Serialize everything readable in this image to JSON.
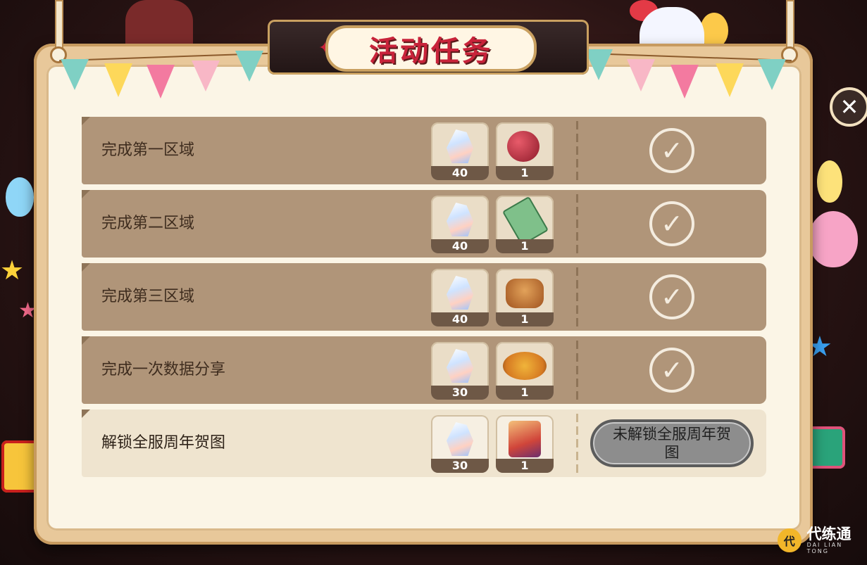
{
  "title": "活动任务",
  "close_icon": "close-icon",
  "rows": [
    {
      "label": "完成第一区域",
      "rewards": [
        {
          "icon": "crystal-icon",
          "count": "40"
        },
        {
          "icon": "fruit-bomb-icon",
          "count": "1"
        }
      ],
      "status": "completed"
    },
    {
      "label": "完成第二区域",
      "rewards": [
        {
          "icon": "crystal-icon",
          "count": "40"
        },
        {
          "icon": "ticket-icon",
          "count": "1"
        }
      ],
      "status": "completed"
    },
    {
      "label": "完成第三区域",
      "rewards": [
        {
          "icon": "crystal-icon",
          "count": "40"
        },
        {
          "icon": "cake-icon",
          "count": "1"
        }
      ],
      "status": "completed"
    },
    {
      "label": "完成一次数据分享",
      "rewards": [
        {
          "icon": "crystal-icon",
          "count": "30"
        },
        {
          "icon": "pizza-icon",
          "count": "1"
        }
      ],
      "status": "completed"
    },
    {
      "label": "解锁全服周年贺图",
      "rewards": [
        {
          "icon": "crystal-icon",
          "count": "30"
        },
        {
          "icon": "character-card-icon",
          "count": "1"
        }
      ],
      "status": "locked",
      "button_label": "未解锁全服周年贺图"
    }
  ],
  "watermark": {
    "name": "代练通",
    "sub": "DAI LIAN TONG"
  },
  "colors": {
    "row_bg": "#b09579",
    "locked_row_bg": "#efe4cf",
    "title_red": "#c8233a",
    "locked_button": "#8d8d8d"
  }
}
